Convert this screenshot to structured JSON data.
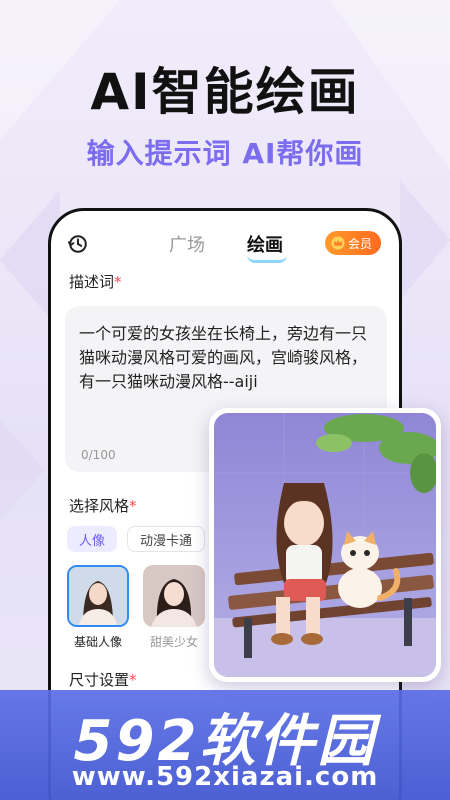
{
  "promo": {
    "headline": "AI智能绘画",
    "subline": "输入提示词 AI帮你画"
  },
  "app": {
    "tabs": [
      {
        "label": "广场",
        "active": false
      },
      {
        "label": "绘画",
        "active": true
      }
    ],
    "vip_label": "会员",
    "description_label": "描述词",
    "required_mark": "*",
    "prompt_text": "一个可爱的女孩坐在长椅上，旁边有一只猫咪动漫风格可爱的画风，宫崎骏风格，有一只猫咪动漫风格--aiji",
    "char_count": "0/100",
    "style_label": "选择风格",
    "style_chips": [
      "人像",
      "动漫卡通"
    ],
    "style_presets": [
      "基础人像",
      "甜美少女"
    ],
    "size_label": "尺寸设置"
  },
  "watermark": {
    "logo": "592软件园",
    "url": "www.592xiazai.com"
  },
  "colors": {
    "accent": "#7b6cf0",
    "vip_orange": "#ff7a20",
    "required": "#ff4a4a",
    "selected_border": "#2f8cf0"
  },
  "icons": [
    "history-icon",
    "crown-icon"
  ]
}
